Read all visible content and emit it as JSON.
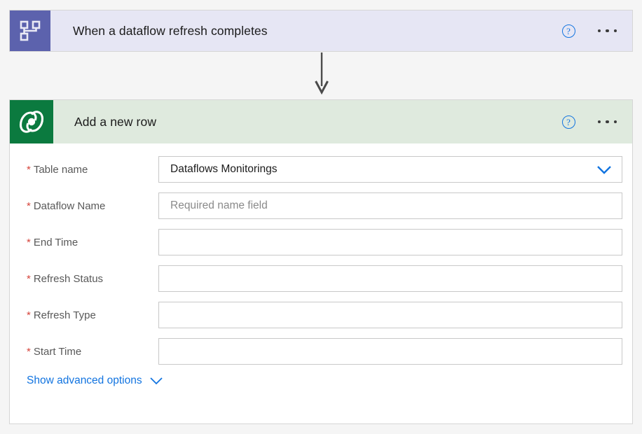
{
  "trigger": {
    "title": "When a dataflow refresh completes",
    "icon": "dataflow-hierarchy-icon",
    "help_label": "?",
    "menu_label": "More commands",
    "header_color": "#e6e6f4",
    "icon_color": "#5c62ad"
  },
  "connector": {
    "icon": "arrow-down-icon",
    "color": "#4a4a4a"
  },
  "action": {
    "title": "Add a new row",
    "icon": "dataverse-icon",
    "help_label": "?",
    "menu_label": "More commands",
    "header_color": "#dfeade",
    "icon_color": "#0b7a3f",
    "fields": [
      {
        "label": "Table name",
        "required": true,
        "value": "Dataflows Monitorings",
        "placeholder": "",
        "is_placeholder": false,
        "has_dropdown": true
      },
      {
        "label": "Dataflow Name",
        "required": true,
        "value": "",
        "placeholder": "Required name field",
        "is_placeholder": true,
        "has_dropdown": false
      },
      {
        "label": "End Time",
        "required": true,
        "value": "",
        "placeholder": "",
        "is_placeholder": false,
        "has_dropdown": false
      },
      {
        "label": "Refresh Status",
        "required": true,
        "value": "",
        "placeholder": "",
        "is_placeholder": false,
        "has_dropdown": false
      },
      {
        "label": "Refresh Type",
        "required": true,
        "value": "",
        "placeholder": "",
        "is_placeholder": false,
        "has_dropdown": false
      },
      {
        "label": "Start Time",
        "required": true,
        "value": "",
        "placeholder": "",
        "is_placeholder": false,
        "has_dropdown": false
      }
    ],
    "advanced_options_label": "Show advanced options",
    "required_marker": "*",
    "link_color": "#1274e0"
  }
}
